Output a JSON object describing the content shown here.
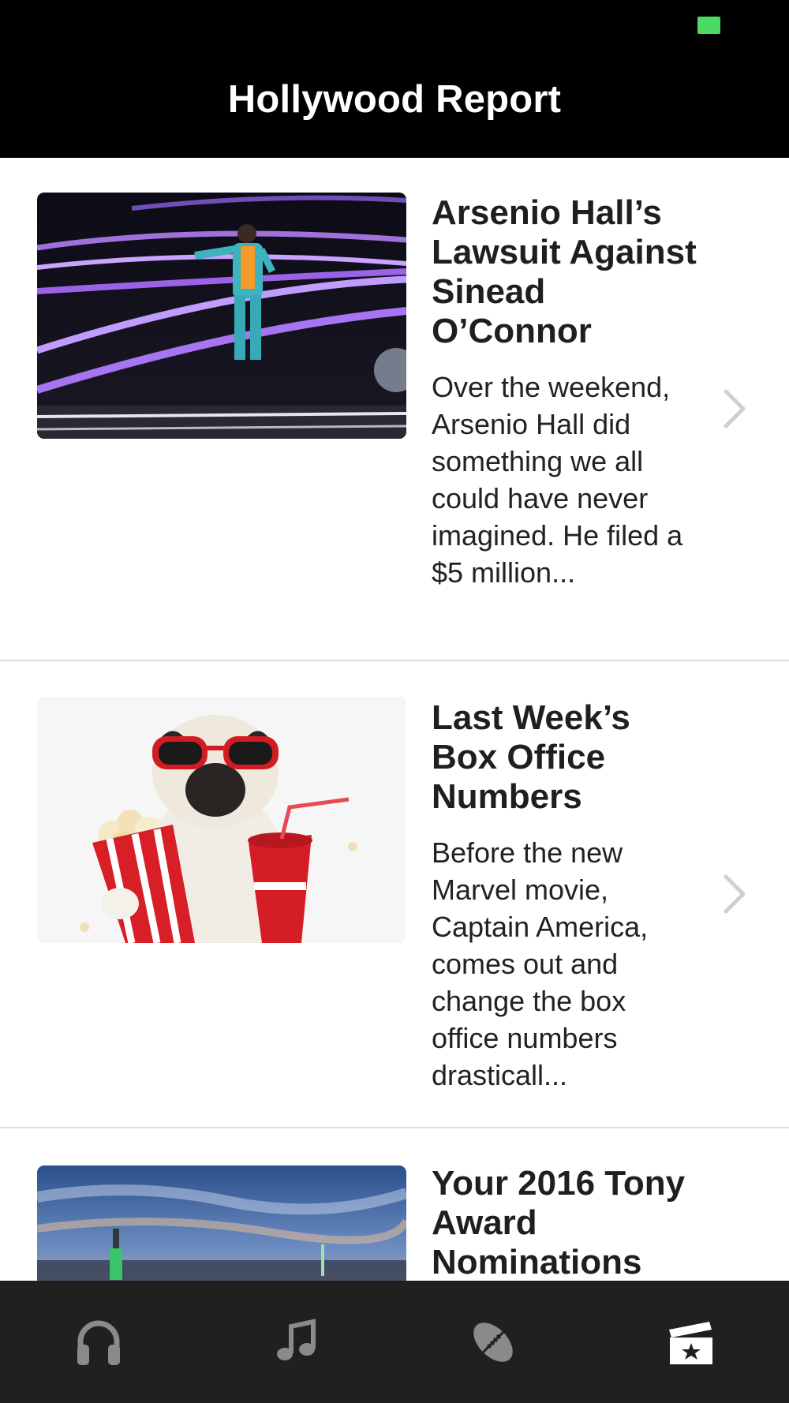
{
  "header": {
    "title": "Hollywood Report"
  },
  "articles": [
    {
      "title": "Arsenio Hall’s Lawsuit Against Sinead O’Connor",
      "summary": "Over the weekend, Arsenio Hall did something we all could have never imagined. He filed a $5 million...",
      "image": "concert-performer-photo"
    },
    {
      "title": "Last Week’s Box Office Numbers",
      "summary": "Before the new Marvel movie, Captain America, comes out and change the box office numbers drasticall...",
      "image": "pug-popcorn-photo"
    },
    {
      "title": "Your 2016 Tony Award Nominations",
      "summary": "",
      "image": "city-skyline-photo"
    }
  ],
  "tabbar": {
    "tabs": [
      {
        "icon": "headphones-icon",
        "active": false
      },
      {
        "icon": "music-note-icon",
        "active": false
      },
      {
        "icon": "football-icon",
        "active": false
      },
      {
        "icon": "movie-clapper-icon",
        "active": true
      }
    ]
  },
  "colors": {
    "header_bg": "#000000",
    "tabbar_bg": "#202020",
    "battery": "#4cd964",
    "icon_inactive": "#8a8a8a",
    "icon_active": "#ffffff"
  }
}
